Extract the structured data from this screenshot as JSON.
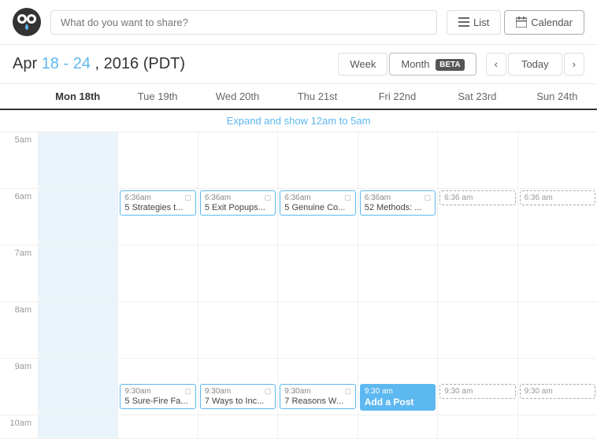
{
  "header": {
    "search_placeholder": "What do you want to share?",
    "list_btn": "List",
    "calendar_btn": "Calendar"
  },
  "toolbar": {
    "date_month": "Apr",
    "date_days": "18 - 24",
    "date_year": "2016",
    "date_tz": "(PDT)",
    "week_btn": "Week",
    "month_btn": "Month",
    "month_badge": "BETA",
    "today_btn": "Today"
  },
  "days": [
    {
      "label": "Mon 18th",
      "is_today": true
    },
    {
      "label": "Tue 19th",
      "is_today": false
    },
    {
      "label": "Wed 20th",
      "is_today": false
    },
    {
      "label": "Thu 21st",
      "is_today": false
    },
    {
      "label": "Fri 22nd",
      "is_today": false
    },
    {
      "label": "Sat 23rd",
      "is_today": false
    },
    {
      "label": "Sun 24th",
      "is_today": false
    }
  ],
  "expand_label": "Expand and show 12am to 5am",
  "time_slots": [
    {
      "label": "5am"
    },
    {
      "label": "6am"
    },
    {
      "label": "7am"
    },
    {
      "label": "8am"
    },
    {
      "label": "9am"
    },
    {
      "label": "10am"
    }
  ],
  "events": {
    "row_7am": [
      {
        "col": 1,
        "time": "6:36am",
        "title": "5 Strategies t...",
        "type": "normal"
      },
      {
        "col": 2,
        "time": "6:36am",
        "title": "5 Exit Popups...",
        "type": "normal"
      },
      {
        "col": 3,
        "time": "6:36am",
        "title": "5 Genuine Co...",
        "type": "normal"
      },
      {
        "col": 4,
        "time": "6:36am",
        "title": "52 Methods: ...",
        "type": "normal"
      },
      {
        "col": 5,
        "time": "6:36 am",
        "title": "",
        "type": "dashed"
      },
      {
        "col": 6,
        "time": "6:36 am",
        "title": "",
        "type": "dashed"
      }
    ],
    "row_10am": [
      {
        "col": 1,
        "time": "9:30am",
        "title": "5 Sure-Fire Fa...",
        "type": "normal"
      },
      {
        "col": 2,
        "time": "9:30am",
        "title": "7 Ways to Inc...",
        "type": "normal"
      },
      {
        "col": 3,
        "time": "9:30am",
        "title": "7 Reasons W...",
        "type": "normal"
      },
      {
        "col": 4,
        "time": "9:30 am",
        "title": "Add a Post",
        "type": "blue"
      },
      {
        "col": 5,
        "time": "9:30 am",
        "title": "",
        "type": "dashed"
      },
      {
        "col": 6,
        "time": "9:30 am",
        "title": "",
        "type": "dashed"
      }
    ]
  }
}
